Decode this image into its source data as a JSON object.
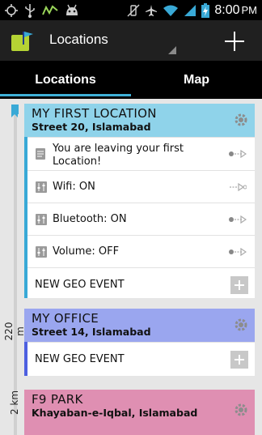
{
  "status_bar": {
    "time": "8:00",
    "ampm": "PM",
    "left_icons": [
      "gps-icon",
      "usb-icon",
      "tracking-icon",
      "android-icon"
    ],
    "right_icons": [
      "vibrate-off-icon",
      "airplane-icon",
      "wifi-icon",
      "signal-icon",
      "battery-charging-icon"
    ]
  },
  "action_bar": {
    "title": "Locations"
  },
  "tabs": [
    {
      "label": "Locations",
      "selected": true
    },
    {
      "label": "Map",
      "selected": false
    }
  ],
  "colors": {
    "accent": "#3fb0d8",
    "first_location": "#8fd3ea",
    "office": "#9aa6ef",
    "park": "#df8fb2"
  },
  "distance_labels": [
    "220 m",
    "2 km"
  ],
  "locations": [
    {
      "name": "MY FIRST LOCATION",
      "address": "Street 20, Islamabad",
      "events": [
        {
          "icon": "message-icon",
          "text": "You are leaving your first Location!"
        },
        {
          "icon": "settings-slider-icon",
          "text": "Wifi:  ON"
        },
        {
          "icon": "settings-slider-icon",
          "text": "Bluetooth:  ON"
        },
        {
          "icon": "settings-slider-icon",
          "text": "Volume:  OFF"
        }
      ],
      "new_event_label": "NEW GEO EVENT"
    },
    {
      "name": "MY OFFICE",
      "address": "Street 14, Islamabad",
      "events": [],
      "new_event_label": "NEW GEO EVENT"
    },
    {
      "name": "F9 PARK",
      "address": "Khayaban-e-Iqbal, Islamabad",
      "events": []
    }
  ]
}
